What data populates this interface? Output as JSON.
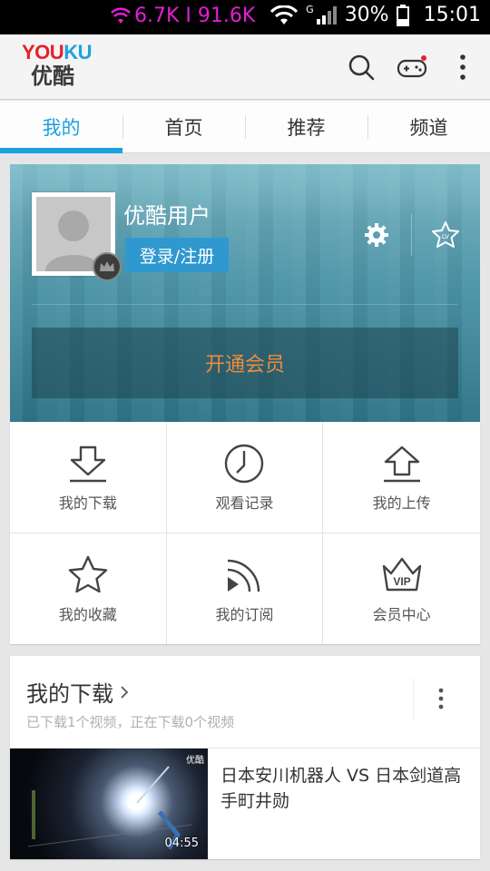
{
  "status_bar": {
    "network_speed": "6.7K I 91.6K",
    "signal_type": "G",
    "battery": "30%",
    "time": "15:01"
  },
  "header": {
    "logo_en_a": "YOU",
    "logo_en_b": "KU",
    "logo_cn": "优酷",
    "icons": [
      "search-icon",
      "gamepad-icon",
      "more-vert-icon"
    ]
  },
  "tabs": [
    {
      "label": "我的",
      "active": true
    },
    {
      "label": "首页",
      "active": false
    },
    {
      "label": "推荐",
      "active": false
    },
    {
      "label": "频道",
      "active": false
    }
  ],
  "profile": {
    "username": "优酷用户",
    "login_label": "登录/注册",
    "level_badge": "LV",
    "vip_label": "开通会员"
  },
  "grid": [
    {
      "label": "我的下载",
      "icon": "download-icon"
    },
    {
      "label": "观看记录",
      "icon": "clock-icon"
    },
    {
      "label": "我的上传",
      "icon": "upload-icon"
    },
    {
      "label": "我的收藏",
      "icon": "star-icon"
    },
    {
      "label": "我的订阅",
      "icon": "subscription-icon"
    },
    {
      "label": "会员中心",
      "icon": "vip-crown-icon",
      "icon_text": "VIP"
    }
  ],
  "downloads": {
    "title": "我的下载",
    "subtitle": "已下载1个视频，正在下载0个视频",
    "items": [
      {
        "title": "日本安川机器人 VS 日本剑道高手町井勋",
        "duration": "04:55",
        "tag": "优酷"
      }
    ]
  },
  "colors": {
    "accent": "#1aa1e1",
    "vip_orange": "#f08a3c",
    "net_magenta": "#e21fd3"
  }
}
